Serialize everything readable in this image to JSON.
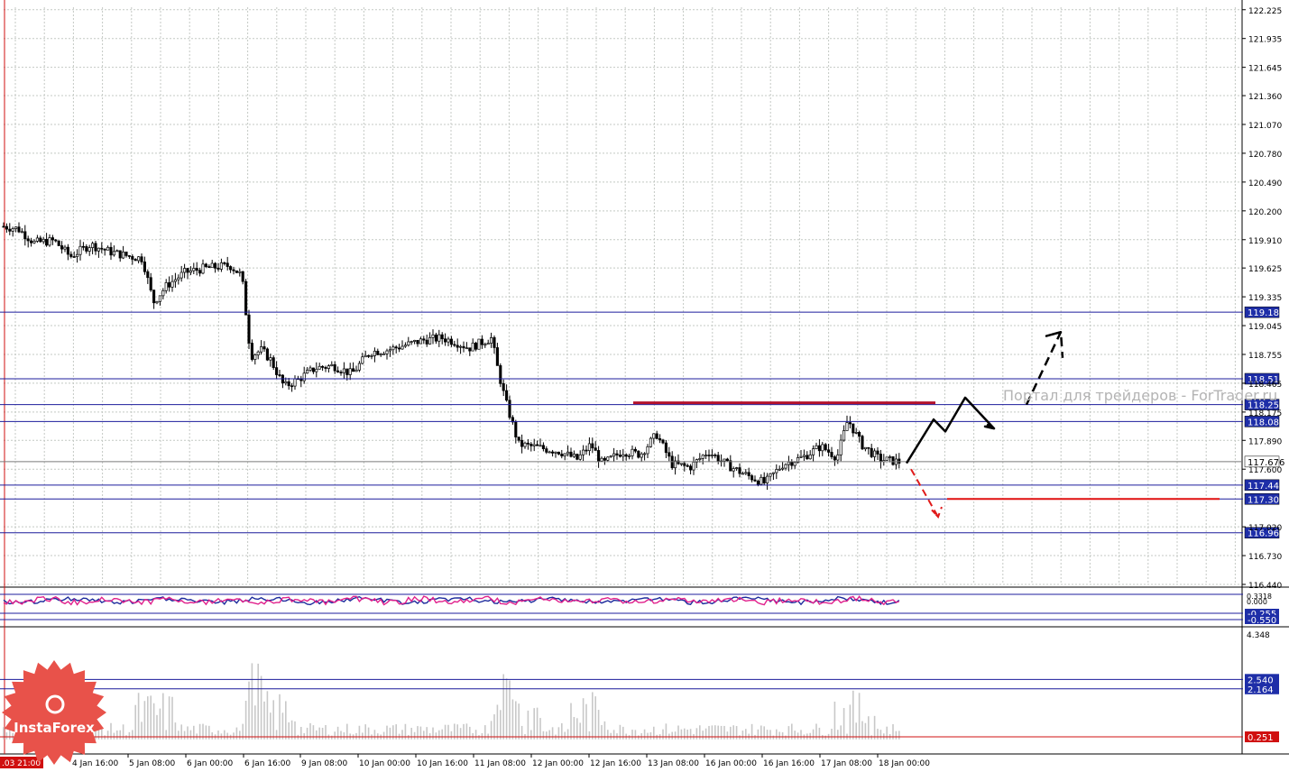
{
  "chart_data": {
    "type": "candlestick",
    "background": "#ffffff",
    "colors": {
      "grid": "#c4c9c4",
      "candle": "#000000",
      "level_line": "#1c1c9c",
      "level_label_bg": "#1e2ea8",
      "level_label_text": "#ffffff",
      "resistance_line": "#b4122c",
      "support_line": "#e01010",
      "bullish_arrow": "#000000",
      "bearish_arrow": "#e01a1a",
      "osc_main": "#1c2a9c",
      "osc_signal": "#e0208c",
      "volume_bar": "#c8c8c8",
      "zero_line": "#d01010",
      "watermark": "#b4b4b4",
      "logo_bg": "#e8524a"
    },
    "watermark": "Портал для трейдеров - ForTrader.ru",
    "logo": "InstaForex",
    "price_panel": {
      "ylim": [
        116.44,
        122.25
      ],
      "ticks": [
        "122.225",
        "121.935",
        "121.645",
        "121.360",
        "121.070",
        "120.780",
        "120.490",
        "120.200",
        "119.910",
        "119.625",
        "119.335",
        "119.045",
        "118.755",
        "118.465",
        "118.175",
        "117.890",
        "117.600",
        "117.020",
        "116.730",
        "116.440"
      ],
      "levels": [
        "119.18",
        "118.51",
        "118.25",
        "118.08",
        "117.676",
        "117.44",
        "117.30",
        "116.96"
      ],
      "current_price": "117.676",
      "resistance": 118.25,
      "support": 117.3
    },
    "oscillator_panel": {
      "ticks": [
        "0.3318",
        "0.000"
      ],
      "levels": [
        "-0.255",
        "-0.550"
      ]
    },
    "volume_panel": {
      "ticks": [
        "4.348"
      ],
      "levels": [
        "2.540",
        "2.164",
        "0.251"
      ]
    },
    "x_labels": [
      "4 Jan 16:00",
      "5 Jan 08:00",
      "6 Jan 00:00",
      "6 Jan 16:00",
      "9 Jan 08:00",
      "10 Jan 00:00",
      "10 Jan 16:00",
      "11 Jan 08:00",
      "12 Jan 00:00",
      "12 Jan 16:00",
      "13 Jan 08:00",
      "16 Jan 00:00",
      "16 Jan 16:00",
      "17 Jan 08:00",
      "18 Jan 00:00"
    ],
    "x_label_first": ".03 21:00",
    "series_anchors": [
      [
        0,
        120.05
      ],
      [
        20,
        120.02
      ],
      [
        38,
        119.88
      ],
      [
        60,
        119.9
      ],
      [
        78,
        119.74
      ],
      [
        100,
        119.86
      ],
      [
        125,
        119.78
      ],
      [
        145,
        119.74
      ],
      [
        158,
        119.72
      ],
      [
        170,
        119.28
      ],
      [
        185,
        119.45
      ],
      [
        205,
        119.58
      ],
      [
        225,
        119.62
      ],
      [
        255,
        119.65
      ],
      [
        268,
        119.55
      ],
      [
        278,
        118.74
      ],
      [
        290,
        118.8
      ],
      [
        300,
        118.7
      ],
      [
        315,
        118.43
      ],
      [
        330,
        118.5
      ],
      [
        350,
        118.62
      ],
      [
        370,
        118.64
      ],
      [
        390,
        118.56
      ],
      [
        410,
        118.78
      ],
      [
        430,
        118.8
      ],
      [
        450,
        118.85
      ],
      [
        470,
        118.9
      ],
      [
        490,
        118.92
      ],
      [
        505,
        118.88
      ],
      [
        520,
        118.82
      ],
      [
        545,
        118.92
      ],
      [
        552,
        118.6
      ],
      [
        560,
        118.3
      ],
      [
        575,
        117.85
      ],
      [
        595,
        117.82
      ],
      [
        620,
        117.78
      ],
      [
        640,
        117.7
      ],
      [
        655,
        117.85
      ],
      [
        668,
        117.65
      ],
      [
        690,
        117.78
      ],
      [
        710,
        117.75
      ],
      [
        728,
        117.95
      ],
      [
        745,
        117.65
      ],
      [
        765,
        117.62
      ],
      [
        785,
        117.78
      ],
      [
        805,
        117.65
      ],
      [
        825,
        117.55
      ],
      [
        848,
        117.46
      ],
      [
        868,
        117.65
      ],
      [
        890,
        117.72
      ],
      [
        910,
        117.83
      ],
      [
        928,
        117.72
      ],
      [
        940,
        118.1
      ],
      [
        955,
        117.85
      ],
      [
        975,
        117.7
      ],
      [
        1000,
        117.67
      ]
    ],
    "bull_path": [
      [
        1005,
        117.66
      ],
      [
        1035,
        118.1
      ],
      [
        1048,
        117.98
      ],
      [
        1070,
        118.32
      ],
      [
        1102,
        118.01
      ],
      [
        1092,
        118.03
      ],
      [
        1102,
        118.01
      ],
      [
        1094,
        118.05
      ]
    ],
    "bull_path2": [
      [
        1138,
        118.25
      ],
      [
        1176,
        118.98
      ],
      [
        1160,
        118.94
      ],
      [
        1176,
        118.98
      ],
      [
        1178,
        118.72
      ]
    ],
    "bear_path": [
      [
        1010,
        117.6
      ],
      [
        1040,
        117.12
      ],
      [
        1033,
        117.19
      ],
      [
        1040,
        117.12
      ],
      [
        1044,
        117.22
      ]
    ],
    "osc_amplitude": 0.25,
    "volume_max": 4.348
  }
}
